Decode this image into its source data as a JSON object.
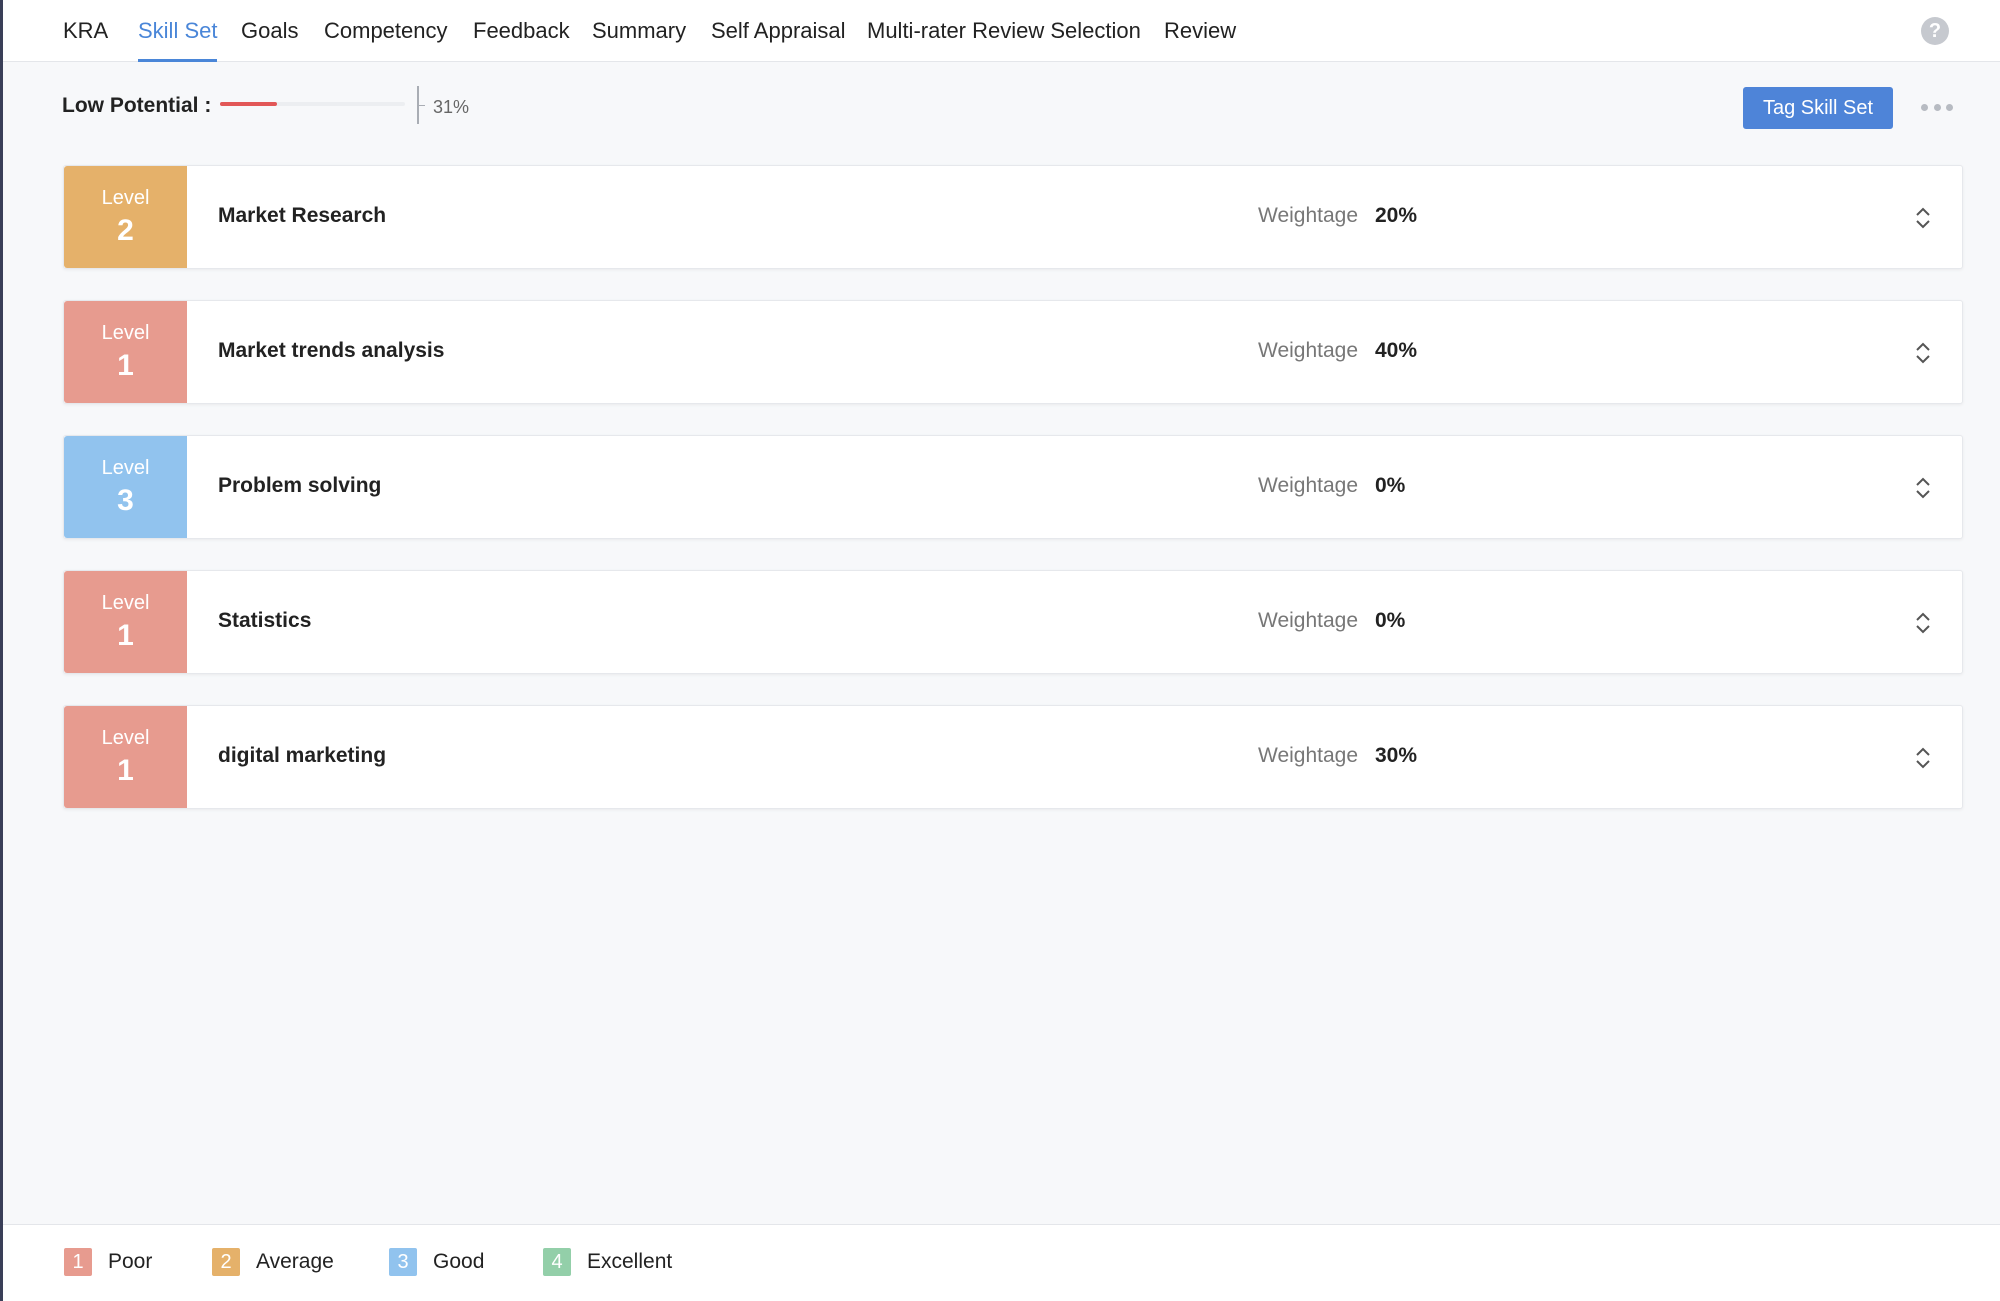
{
  "tabs": [
    {
      "label": "KRA",
      "active": false
    },
    {
      "label": "Skill Set",
      "active": true
    },
    {
      "label": "Goals",
      "active": false
    },
    {
      "label": "Competency",
      "active": false
    },
    {
      "label": "Feedback",
      "active": false
    },
    {
      "label": "Summary",
      "active": false
    },
    {
      "label": "Self Appraisal",
      "active": false
    },
    {
      "label": "Multi-rater Review Selection",
      "active": false
    },
    {
      "label": "Review",
      "active": false
    }
  ],
  "help_icon": "question-mark-icon",
  "potential": {
    "label": "Low Potential :",
    "value_text": "31%",
    "progress_percent": 31,
    "bar_color": "#e25757"
  },
  "tag_button_label": "Tag Skill Set",
  "more_icon": "more-horizontal-icon",
  "level_word": "Level",
  "weightage_label": "Weightage",
  "skills": [
    {
      "name": "Market Research",
      "level": "2",
      "weightage": "20%",
      "color": "#e5b16a"
    },
    {
      "name": "Market trends analysis",
      "level": "1",
      "weightage": "40%",
      "color": "#e79b8f"
    },
    {
      "name": "Problem solving",
      "level": "3",
      "weightage": "0%",
      "color": "#91c3ee"
    },
    {
      "name": "Statistics",
      "level": "1",
      "weightage": "0%",
      "color": "#e79b8f"
    },
    {
      "name": "digital marketing",
      "level": "1",
      "weightage": "30%",
      "color": "#e79b8f"
    }
  ],
  "legend": [
    {
      "num": "1",
      "label": "Poor",
      "color": "#e79b8f"
    },
    {
      "num": "2",
      "label": "Average",
      "color": "#e5b16a"
    },
    {
      "num": "3",
      "label": "Good",
      "color": "#91c3ee"
    },
    {
      "num": "4",
      "label": "Excellent",
      "color": "#93cfa9"
    }
  ]
}
